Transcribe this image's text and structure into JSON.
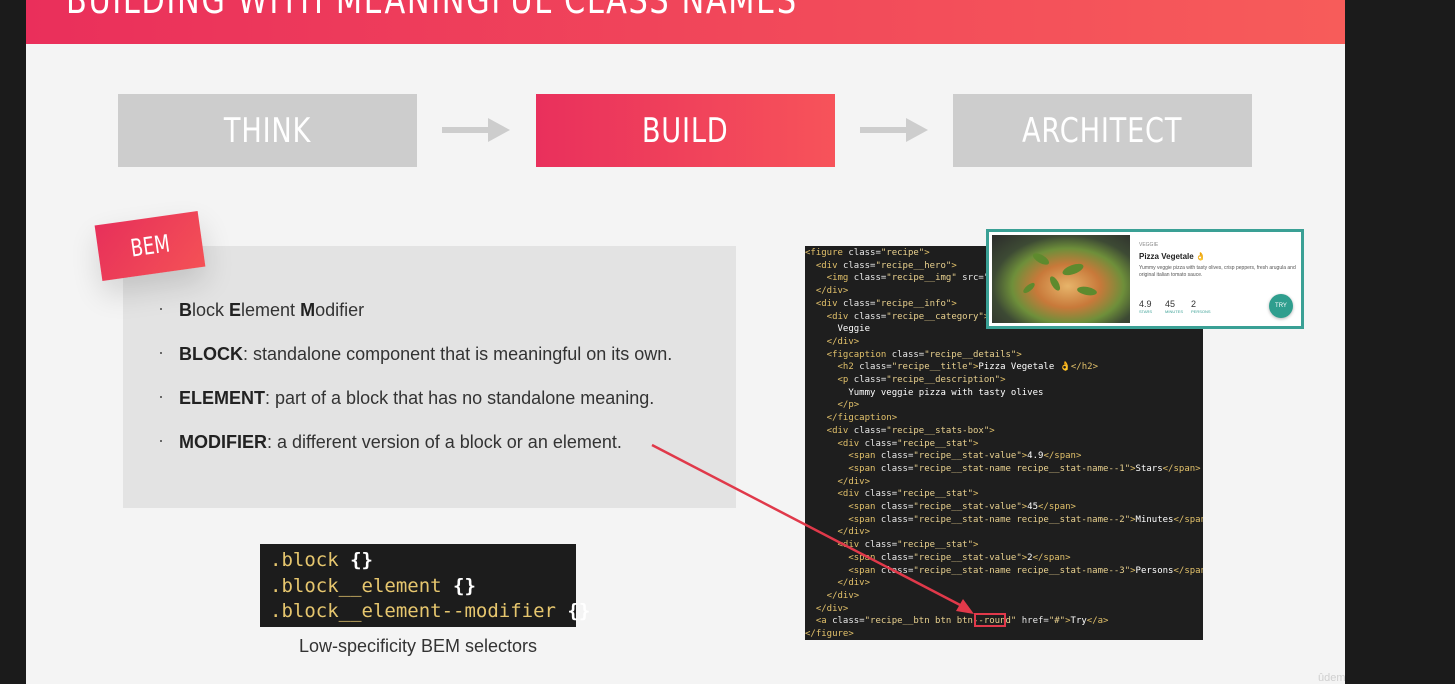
{
  "header": {
    "title": "BUILDING WITH MEANINGFUL CLASS NAMES"
  },
  "steps": [
    "THINK",
    "BUILD",
    "ARCHITECT"
  ],
  "bem": {
    "tag": "BEM",
    "items": [
      {
        "bold": "",
        "text": ""
      },
      {
        "bold": "BLOCK",
        "text": ": standalone component that is meaningful on its own."
      },
      {
        "bold": "ELEMENT",
        "text": ": part of a block that has no standalone meaning."
      },
      {
        "bold": "MODIFIER",
        "text": ": a different version of a block or an element."
      }
    ],
    "first_item": {
      "b1": "B",
      "r1": "lock ",
      "b2": "E",
      "r2": "lement ",
      "b3": "M",
      "r3": "odifier"
    }
  },
  "selectors": {
    "lines": [
      ".block ",
      ".block__element ",
      ".block__element--modifier "
    ],
    "braces": "{}",
    "caption": "Low-specificity BEM selectors"
  },
  "code": {
    "l1_t1": "<figure ",
    "l1_a": "class=",
    "l1_s": "\"recipe\"",
    "l1_t2": ">",
    "l2_t1": "  <div ",
    "l2_a": "class=",
    "l2_s": "\"recipe__hero\"",
    "l2_t2": ">",
    "l3_t1": "    <img ",
    "l3_a": "class=",
    "l3_s": "\"recipe__img\"",
    "l3_rest": " src=\"",
    "l4": "  </div>",
    "l5_t1": "  <div ",
    "l5_a": "class=",
    "l5_s": "\"recipe__info\"",
    "l5_t2": ">",
    "l6_t1": "    <div ",
    "l6_a": "class=",
    "l6_s": "\"recipe__category\"",
    "l6_t2": ">",
    "l7": "      Veggie",
    "l8": "    </div>",
    "l9_t1": "    <figcaption ",
    "l9_a": "class=",
    "l9_s": "\"recipe__details\"",
    "l9_t2": ">",
    "l10_t1": "      <h2 ",
    "l10_a": "class=",
    "l10_s": "\"recipe__title\"",
    "l10_t2": ">",
    "l10_x": "Pizza Vegetale 👌",
    "l10_t3": "</h2>",
    "l11_t1": "      <p ",
    "l11_a": "class=",
    "l11_s": "\"recipe__description\"",
    "l11_t2": ">",
    "l12": "        Yummy veggie pizza with tasty olives",
    "l13": "      </p>",
    "l14": "    </figcaption>",
    "l15_t1": "    <div ",
    "l15_a": "class=",
    "l15_s": "\"recipe__stats-box\"",
    "l15_t2": ">",
    "l16_t1": "      <div ",
    "l16_a": "class=",
    "l16_s": "\"recipe__stat\"",
    "l16_t2": ">",
    "l17_t1": "        <span ",
    "l17_a": "class=",
    "l17_s": "\"recipe__stat-value\"",
    "l17_t2": ">",
    "l17_x": "4.9",
    "l17_t3": "</span>",
    "l18_t1": "        <span ",
    "l18_a": "class=",
    "l18_s": "\"recipe__stat-name recipe__stat-name--1\"",
    "l18_t2": ">",
    "l18_x": "Stars",
    "l18_t3": "</span>",
    "l19": "      </div>",
    "l20_t1": "      <div ",
    "l20_a": "class=",
    "l20_s": "\"recipe__stat\"",
    "l20_t2": ">",
    "l21_t1": "        <span ",
    "l21_a": "class=",
    "l21_s": "\"recipe__stat-value\"",
    "l21_t2": ">",
    "l21_x": "45",
    "l21_t3": "</span>",
    "l22_t1": "        <span ",
    "l22_a": "class=",
    "l22_s": "\"recipe__stat-name recipe__stat-name--2\"",
    "l22_t2": ">",
    "l22_x": "Minutes",
    "l22_t3": "</span>",
    "l23": "      </div>",
    "l24_t1": "      <div ",
    "l24_a": "class=",
    "l24_s": "\"recipe__stat\"",
    "l24_t2": ">",
    "l25_t1": "        <span ",
    "l25_a": "class=",
    "l25_s": "\"recipe__stat-value\"",
    "l25_t2": ">",
    "l25_x": "2",
    "l25_t3": "</span>",
    "l26_t1": "        <span ",
    "l26_a": "class=",
    "l26_s": "\"recipe__stat-name recipe__stat-name--3\"",
    "l26_t2": ">",
    "l26_x": "Persons",
    "l26_t3": "</span>",
    "l27": "      </div>",
    "l28": "    </div>",
    "l29": "  </div>",
    "l30_t1": "  <a ",
    "l30_a": "class=",
    "l30_s": "\"recipe__btn btn btn--round\"",
    "l30_a2": " href=",
    "l30_s2": "\"#\"",
    "l30_t2": ">",
    "l30_x": "Try",
    "l30_t3": "</a>",
    "l31": "</figure>"
  },
  "card": {
    "category": "VEGGIE",
    "title": "Pizza Vegetale 👌",
    "description": "Yummy veggie pizza with tasty olives, crisp peppers, fresh arugula and original italian tomato sauce.",
    "stats": [
      {
        "value": "4.9",
        "name": "STARS"
      },
      {
        "value": "45",
        "name": "MINUTES"
      },
      {
        "value": "2",
        "name": "PERSONS"
      }
    ],
    "button": "TRY"
  },
  "watermark": "ûdemy",
  "colors": {
    "accent": "#eb3359",
    "teal": "#3aa095",
    "highlight": "#e0394a"
  }
}
